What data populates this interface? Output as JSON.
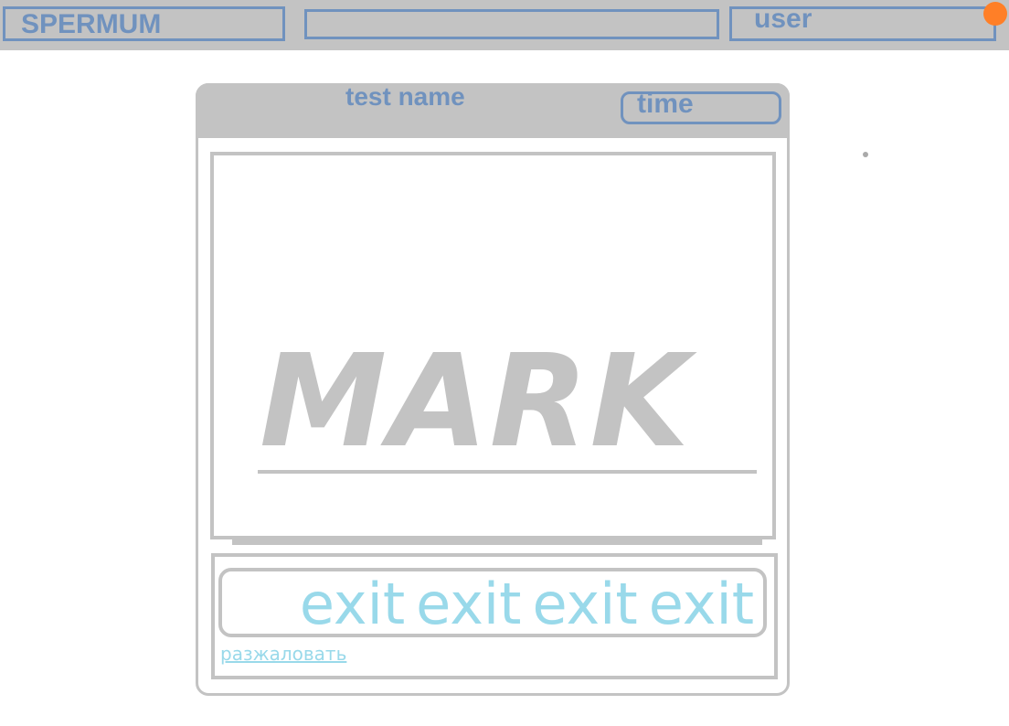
{
  "colors": {
    "bar_bg": "#c3c3c3",
    "accent_blue": "#7092be",
    "link_light_blue": "#99d9ea",
    "notify_orange": "#ff7f27"
  },
  "header": {
    "app_title": "SPERMUM",
    "search": {
      "value": "",
      "placeholder": ""
    },
    "user_label": "user",
    "notification_icon": "notification-dot-icon"
  },
  "test_window": {
    "title": "test name",
    "time_label": "time",
    "mark_label": "MARK",
    "exit_buttons": [
      "exit",
      "exit",
      "exit",
      "exit"
    ],
    "demote_link": "разжаловать"
  }
}
